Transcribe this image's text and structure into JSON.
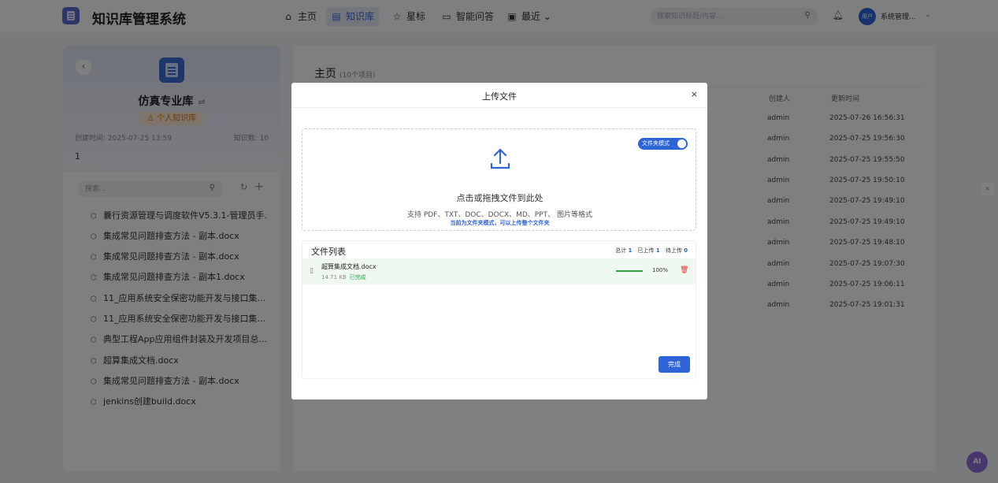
{
  "header": {
    "app_title": "知识库管理系统",
    "nav": [
      {
        "label": "主页",
        "icon": "home-icon",
        "glyph": "⌂"
      },
      {
        "label": "知识库",
        "icon": "database-icon",
        "glyph": "▤",
        "active": true
      },
      {
        "label": "星标",
        "icon": "star-icon",
        "glyph": "☆"
      },
      {
        "label": "智能问答",
        "icon": "chat-icon",
        "glyph": "▭"
      },
      {
        "label": "最近",
        "icon": "calendar-icon",
        "glyph": "▣",
        "caret": "⌄"
      }
    ],
    "search_placeholder": "搜索知识标题/内容...",
    "avatar_text": "用户",
    "user_name": "系统管理..."
  },
  "left_panel": {
    "kb_name": "仿真专业库",
    "kb_badge": "♙ 个人知识库",
    "created": "创建时间: 2025-07-25 13:59",
    "count": "知识数: 10",
    "desc": "1",
    "search_placeholder": "搜索...",
    "files": [
      "曩行资源管理与调度软件V5.3.1-管理员手...",
      "集成常见问题排查方法 - 副本.docx",
      "集成常见问题排查方法 - 副本.docx",
      "集成常见问题排查方法 - 副本1.docx",
      "11_应用系统安全保密功能开发与接口集...",
      "11_应用系统安全保密功能开发与接口集...",
      "典型工程App应用组件封装及开发项目总...",
      "超算集成文档.docx",
      "集成常见问题排查方法 - 副本.docx",
      "jenkins创建build.docx"
    ]
  },
  "main": {
    "title": "主页",
    "count": "(10个项目)",
    "col_creator": "创建人",
    "col_updated": "更新时间",
    "rows": [
      {
        "creator": "admin",
        "time": "2025-07-26 16:56:31"
      },
      {
        "creator": "admin",
        "time": "2025-07-25 19:56:30"
      },
      {
        "creator": "admin",
        "time": "2025-07-25 19:55:50"
      },
      {
        "creator": "admin",
        "time": "2025-07-25 19:50:10"
      },
      {
        "creator": "admin",
        "time": "2025-07-25 19:49:10"
      },
      {
        "creator": "admin",
        "time": "2025-07-25 19:49:10"
      },
      {
        "creator": "admin",
        "time": "2025-07-25 19:48:10"
      },
      {
        "creator": "admin",
        "time": "2025-07-25 19:07:30"
      },
      {
        "creator": "admin",
        "time": "2025-07-25 19:06:11"
      },
      {
        "creator": "admin",
        "time": "2025-07-25 19:01:31"
      }
    ]
  },
  "modal": {
    "title": "上传文件",
    "close": "×",
    "folder_mode_label": "文件夹模式",
    "drop_main": "点击或拖拽文件到此处",
    "drop_sub": "支持 PDF、TXT、DOC、DOCX、MD、PPT、 图片等格式",
    "drop_hint": "当前为文件夹模式，可以上传整个文件夹",
    "file_list_title": "文件列表",
    "stats": {
      "total_label": "总计",
      "total": "1",
      "uploaded_label": "已上传",
      "uploaded": "1",
      "pending_label": "待上传",
      "pending": "0"
    },
    "file": {
      "name": "超算集成文档.docx",
      "size": "14.71 KB",
      "status": "已完成",
      "progress": 100,
      "progress_text": "100%"
    },
    "done_label": "完成"
  },
  "floating": {
    "ai_label": "AI",
    "side_glyph": "✕"
  },
  "colors": {
    "primary": "#2e64d8",
    "success": "#2aa746",
    "danger": "#e53935",
    "badge": "#e07a16"
  }
}
